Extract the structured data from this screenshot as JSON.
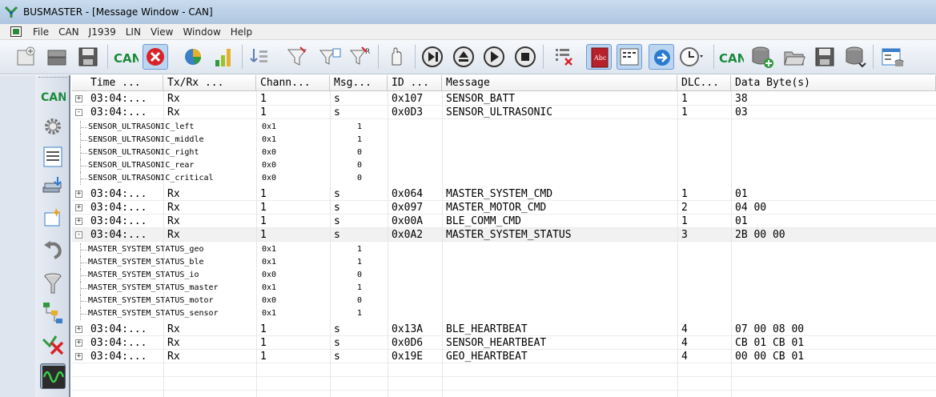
{
  "window": {
    "title": "BUSMASTER - [Message Window - CAN]"
  },
  "menu": [
    "File",
    "CAN",
    "J1939",
    "LIN",
    "View",
    "Window",
    "Help"
  ],
  "toolbar": {
    "can_label_1": "CAN",
    "can_label_2": "CAN"
  },
  "leftbar": {
    "can_label": "CAN"
  },
  "columns": [
    "Time  ...",
    "Tx/Rx  ...",
    "Chann...",
    "Msg...",
    "ID ...",
    "Message",
    "DLC...",
    "Data Byte(s)"
  ],
  "messages": [
    {
      "time": "03:04:...",
      "txrx": "Rx",
      "channel": "1",
      "msg": "s",
      "id": "0x107",
      "message": "SENSOR_BATT",
      "dlc": "1",
      "data": "38",
      "expander": "+"
    },
    {
      "time": "03:04:...",
      "txrx": "Rx",
      "channel": "1",
      "msg": "s",
      "id": "0x0D3",
      "message": "SENSOR_ULTRASONIC",
      "dlc": "1",
      "data": "03",
      "expander": "-",
      "signals": [
        {
          "name": "SENSOR_ULTRASONIC_left",
          "raw": "0x1",
          "value": "1"
        },
        {
          "name": "SENSOR_ULTRASONIC_middle",
          "raw": "0x1",
          "value": "1"
        },
        {
          "name": "SENSOR_ULTRASONIC_right",
          "raw": "0x0",
          "value": "0"
        },
        {
          "name": "SENSOR_ULTRASONIC_rear",
          "raw": "0x0",
          "value": "0"
        },
        {
          "name": "SENSOR_ULTRASONIC_critical",
          "raw": "0x0",
          "value": "0"
        }
      ]
    },
    {
      "time": "03:04:...",
      "txrx": "Rx",
      "channel": "1",
      "msg": "s",
      "id": "0x064",
      "message": "MASTER_SYSTEM_CMD",
      "dlc": "1",
      "data": "01",
      "expander": "+"
    },
    {
      "time": "03:04:...",
      "txrx": "Rx",
      "channel": "1",
      "msg": "s",
      "id": "0x097",
      "message": "MASTER_MOTOR_CMD",
      "dlc": "2",
      "data": "04 00",
      "expander": "+"
    },
    {
      "time": "03:04:...",
      "txrx": "Rx",
      "channel": "1",
      "msg": "s",
      "id": "0x00A",
      "message": "BLE_COMM_CMD",
      "dlc": "1",
      "data": "01",
      "expander": "+"
    },
    {
      "time": "03:04:...",
      "txrx": "Rx",
      "channel": "1",
      "msg": "s",
      "id": "0x0A2",
      "message": "MASTER_SYSTEM_STATUS",
      "dlc": "3",
      "data": "2B 00 00",
      "expander": "-",
      "selected": true,
      "signals": [
        {
          "name": "MASTER_SYSTEM_STATUS_geo",
          "raw": "0x1",
          "value": "1"
        },
        {
          "name": "MASTER_SYSTEM_STATUS_ble",
          "raw": "0x1",
          "value": "1"
        },
        {
          "name": "MASTER_SYSTEM_STATUS_io",
          "raw": "0x0",
          "value": "0"
        },
        {
          "name": "MASTER_SYSTEM_STATUS_master",
          "raw": "0x1",
          "value": "1"
        },
        {
          "name": "MASTER_SYSTEM_STATUS_motor",
          "raw": "0x0",
          "value": "0"
        },
        {
          "name": "MASTER_SYSTEM_STATUS_sensor",
          "raw": "0x1",
          "value": "1"
        }
      ]
    },
    {
      "time": "03:04:...",
      "txrx": "Rx",
      "channel": "1",
      "msg": "s",
      "id": "0x13A",
      "message": "BLE_HEARTBEAT",
      "dlc": "4",
      "data": "07 00 08 00",
      "expander": "+"
    },
    {
      "time": "03:04:...",
      "txrx": "Rx",
      "channel": "1",
      "msg": "s",
      "id": "0x0D6",
      "message": "SENSOR_HEARTBEAT",
      "dlc": "4",
      "data": "CB 01 CB 01",
      "expander": "+"
    },
    {
      "time": "03:04:...",
      "txrx": "Rx",
      "channel": "1",
      "msg": "s",
      "id": "0x19E",
      "message": "GEO_HEARTBEAT",
      "dlc": "4",
      "data": "00 00 CB 01",
      "expander": "+"
    }
  ],
  "colors": {
    "accent": "#1a8a3a",
    "selection": "#bcd6f2",
    "error": "#d8232a"
  }
}
